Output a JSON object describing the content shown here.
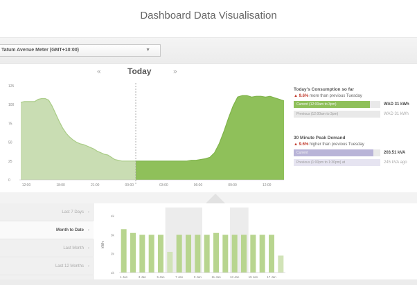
{
  "page": {
    "title": "Dashboard Data Visualisation"
  },
  "meter": {
    "selected": "Tatum Avenue Meter (GMT+10:00)"
  },
  "day_nav": {
    "prev_glyph": "«",
    "label": "Today",
    "next_glyph": "»"
  },
  "main_chart": {
    "y_ticks": [
      "125",
      "100",
      "75",
      "50",
      "25",
      "0"
    ],
    "y_values": [
      125,
      100,
      75,
      50,
      25,
      0
    ],
    "y_max": 125,
    "x_labels": [
      "12:00",
      "18:00",
      "21:00",
      "00:00",
      "03:00",
      "06:00",
      "09:00",
      "12:00"
    ],
    "previous_color": "#c9ddb3",
    "previous_edge": "#a9cc86",
    "current_color": "#8fc05a",
    "current_edge": "#7fb34a",
    "previous": [
      103,
      104,
      104,
      104,
      104,
      107,
      108,
      108,
      106,
      98,
      88,
      78,
      69,
      62,
      57,
      53,
      50,
      48,
      47,
      45,
      43,
      41,
      38,
      36,
      34,
      33,
      30,
      27,
      26,
      25,
      25,
      25,
      25,
      25
    ],
    "current": [
      25,
      25,
      25,
      25,
      25,
      25,
      25,
      25,
      25,
      25,
      25,
      25,
      26,
      26,
      27,
      28,
      30,
      36,
      48,
      64,
      82,
      98,
      110,
      112,
      112,
      110,
      111,
      111,
      110,
      111,
      109,
      107,
      105
    ]
  },
  "consumption": {
    "heading": "Today's Consumption so far",
    "delta_pct": "9.6%",
    "delta_text": "more than previous Tuesday",
    "current_label": "Current (12:00am to 3pm)",
    "current_fill": 0.88,
    "current_value": "WAD 31 kWh",
    "previous_label": "Previous (12:00am to 3pm)",
    "previous_fill": 0.0,
    "previous_value": "WAD 31 kWh"
  },
  "peak": {
    "heading": "30 Minute Peak Demand",
    "delta_pct": "9.6%",
    "delta_text": "higher than previous Tuesday",
    "current_label": "Current",
    "current_fill": 0.92,
    "current_value": "203.51 kVA",
    "previous_label": "Previous (1:00pm to 1:30pm) at",
    "previous_fill": 0.0,
    "previous_value": "245 kVA ago"
  },
  "periods": {
    "items": [
      "Last 7 Days",
      "Month to Date",
      "Last Month",
      "Last 12 Months"
    ],
    "chevron": "›"
  },
  "lower_chart": {
    "y_label": "kWh",
    "y_ticks": [
      "4k",
      "3k",
      "2k",
      "1k"
    ],
    "x_labels": [
      "1 Jan",
      "3 Jan",
      "5 Jan",
      "7 Jan",
      "9 Jan",
      "11 Jan",
      "13 Jan",
      "15 Jan",
      "17 Jan"
    ],
    "bar_color": "#b8d58f",
    "bar_color_weekend": "#d1e3b7",
    "band_color": "#ececec",
    "values": [
      3.3,
      3.1,
      3.0,
      3.0,
      3.0,
      2.1,
      3.0,
      3.0,
      3.0,
      3.0,
      3.1,
      3.0,
      3.0,
      3.0,
      3.0,
      3.0,
      3.0,
      1.9
    ],
    "y_min": 1.0,
    "y_max": 4.3
  }
}
